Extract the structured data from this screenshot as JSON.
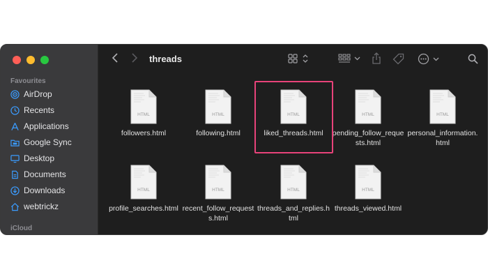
{
  "window": {
    "title": "threads",
    "accent": "#e8437a"
  },
  "sidebar": {
    "favourites_label": "Favourites",
    "items": [
      {
        "label": "AirDrop",
        "icon": "airdrop-icon"
      },
      {
        "label": "Recents",
        "icon": "clock-icon"
      },
      {
        "label": "Applications",
        "icon": "applications-icon"
      },
      {
        "label": "Google Sync",
        "icon": "folder-icon"
      },
      {
        "label": "Desktop",
        "icon": "desktop-icon"
      },
      {
        "label": "Documents",
        "icon": "document-icon"
      },
      {
        "label": "Downloads",
        "icon": "download-icon"
      },
      {
        "label": "webtrickz",
        "icon": "home-icon"
      }
    ],
    "icloud_label": "iCloud"
  },
  "files": [
    {
      "name": "followers.html",
      "badge": "HTML"
    },
    {
      "name": "following.html",
      "badge": "HTML"
    },
    {
      "name": "liked_threads.html",
      "badge": "HTML",
      "selected": true
    },
    {
      "name": "pending_follow_requests.html",
      "badge": "HTML"
    },
    {
      "name": "personal_information.html",
      "badge": "HTML"
    },
    {
      "name": "profile_searches.html",
      "badge": "HTML"
    },
    {
      "name": "recent_follow_requests.html",
      "badge": "HTML"
    },
    {
      "name": "threads_and_replies.html",
      "badge": "HTML"
    },
    {
      "name": "threads_viewed.html",
      "badge": "HTML"
    }
  ]
}
